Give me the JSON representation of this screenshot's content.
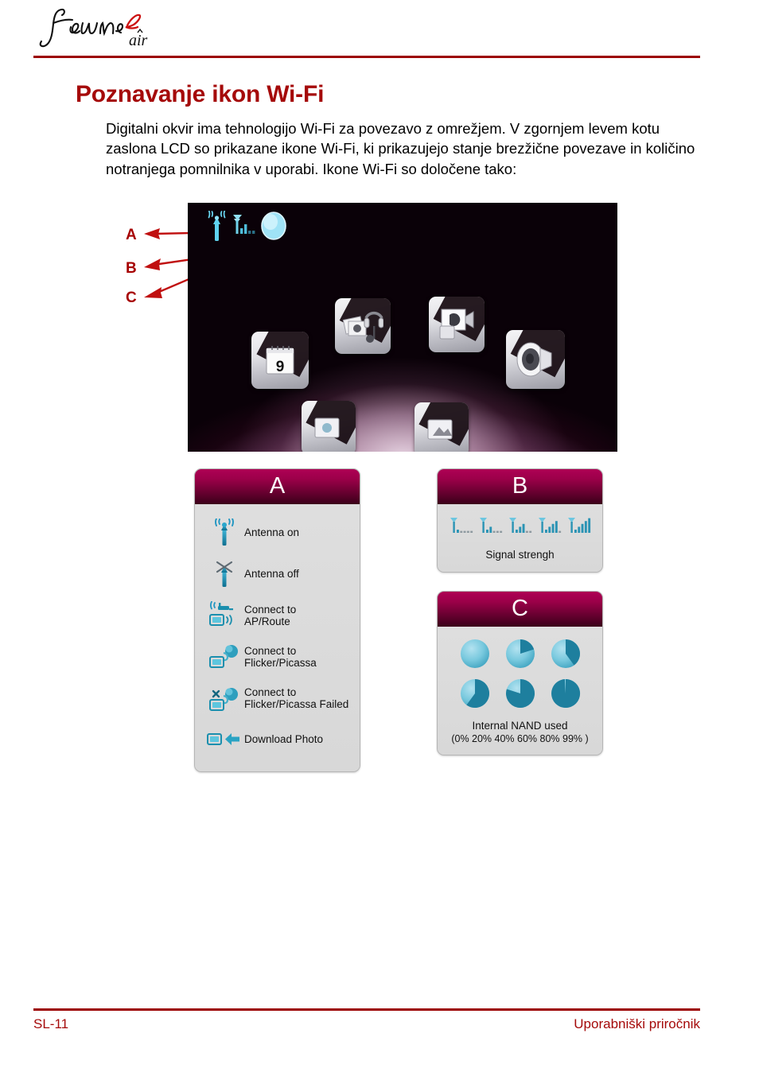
{
  "header": {
    "logo_name": "journe-air-logo",
    "logo_text": "JournE",
    "logo_subtext": "air",
    "rule_color": "#9c0000"
  },
  "page": {
    "title": "Poznavanje ikon Wi-Fi",
    "title_color": "#a50a0a",
    "intro": "Digitalni okvir ima tehnologijo Wi-Fi za povezavo z omrežjem. V zgornjem levem kotu zaslona LCD so prikazane ikone Wi-Fi, ki prikazujejo stanje brezžične povezave in količino notranjega pomnilnika v uporabi. Ikone Wi-Fi so določene tako:"
  },
  "callouts": [
    {
      "label": "A",
      "target": "antenna-status-icon"
    },
    {
      "label": "B",
      "target": "signal-strength-icon"
    },
    {
      "label": "C",
      "target": "nand-usage-icon"
    }
  ],
  "callout_color": "#a60000",
  "device_screenshot": {
    "name": "lcd-home-screen",
    "status_icons": [
      "antenna-on-icon",
      "signal-strength-icon",
      "nand-usage-icon"
    ],
    "apps": [
      "photo-music-icon",
      "video-icon",
      "calendar-icon",
      "speaker-icon",
      "app-icon-5",
      "app-icon-6"
    ],
    "calendar_day": "9"
  },
  "panels": {
    "a": {
      "letter": "A",
      "rows": [
        {
          "icon": "antenna-on-icon",
          "text": "Antenna on"
        },
        {
          "icon": "antenna-off-icon",
          "text": "Antenna off"
        },
        {
          "icon": "connect-ap-route-icon",
          "text": "Connect to\nAP/Route"
        },
        {
          "icon": "connect-flicker-picassa-icon",
          "text": "Connect to\nFlicker/Picassa"
        },
        {
          "icon": "connect-flicker-picassa-failed-icon",
          "text": "Connect to\nFlicker/Picassa Failed"
        },
        {
          "icon": "download-photo-icon",
          "text": "Download Photo"
        }
      ]
    },
    "b": {
      "letter": "B",
      "caption": "Signal strengh",
      "levels": [
        1,
        2,
        3,
        4,
        5
      ],
      "max_bars": 5
    },
    "c": {
      "letter": "C",
      "caption": "Internal NAND used",
      "values_text": "(0% 20% 40% 60% 80% 99% )",
      "percents": [
        0,
        20,
        40,
        60,
        80,
        99
      ]
    }
  },
  "colors": {
    "panel_header_top": "#ae0055",
    "panel_header_bottom": "#3a0019",
    "panel_body": "#dcdcdc",
    "icon_teal": "#1b8fae",
    "icon_teal_dark": "#14708c",
    "icon_light_blue": "#86cde2"
  },
  "footer": {
    "page_number": "SL-11",
    "manual_title": "Uporabniški priročnik",
    "color": "#a50a0a"
  }
}
